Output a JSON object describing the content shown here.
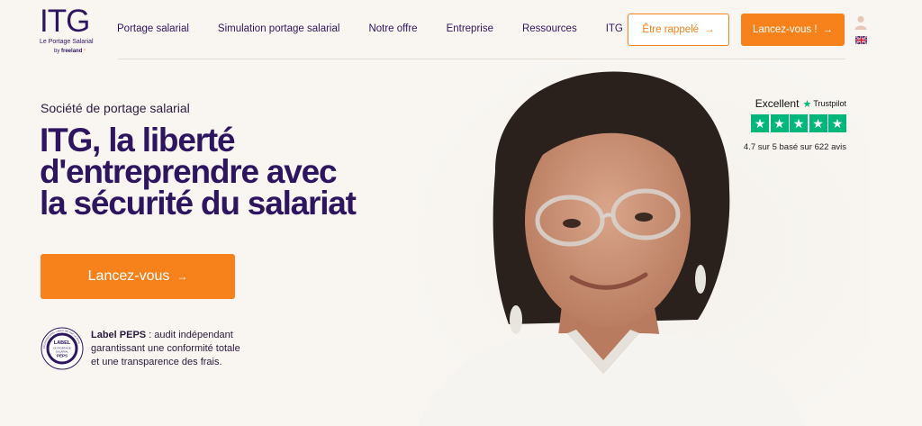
{
  "brand": {
    "logo_text": "ITG",
    "tagline": "Le Portage Salarial",
    "by_prefix": "by",
    "by_name": "freeland"
  },
  "nav": {
    "items": [
      {
        "label": "Portage salarial"
      },
      {
        "label": "Simulation portage salarial"
      },
      {
        "label": "Notre offre"
      },
      {
        "label": "Entreprise"
      },
      {
        "label": "Ressources"
      },
      {
        "label": "ITG"
      }
    ]
  },
  "header_actions": {
    "callback_label": "Être rappelé",
    "start_label": "Lancez-vous !",
    "arrow": "→",
    "user_icon": "user-icon",
    "language_icon": "uk-flag-icon"
  },
  "hero": {
    "eyebrow": "Société de portage salarial",
    "headline_lines": [
      "ITG, la liberté",
      "d'entreprendre avec",
      "la sécurité du salariat"
    ],
    "cta_label": "Lancez-vous",
    "cta_arrow": "→"
  },
  "peps": {
    "badge_lines": [
      "LABEL",
      "DU PORTAGE",
      "SALARIAL",
      "PEPS"
    ],
    "badge_ring": "PROFESSIONNEL LABELLISÉ PAR LE PEPS",
    "title": "Label PEPS",
    "text": " : audit indépendant garantissant une conformité totale et une transparence des frais."
  },
  "trustpilot": {
    "rating_word": "Excellent",
    "brand": "Trustpilot",
    "stars": 5,
    "summary": "4.7 sur 5 basé sur 622 avis",
    "star_color": "#00b67a"
  },
  "colors": {
    "accent": "#f7821b",
    "primary": "#2e1560",
    "background": "#f9f6f2"
  }
}
